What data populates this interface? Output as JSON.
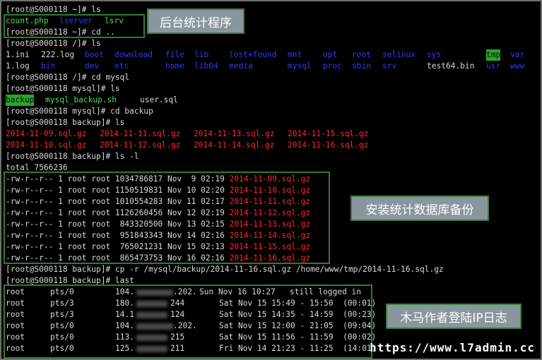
{
  "terminal": {
    "l01": "[root@S000118 ~]# ls",
    "l02": {
      "f1": "count.php",
      "f2": "lserver",
      "f3": "lsrv"
    },
    "l03": "[root@S000118 ~]# cd ..",
    "l04": "[root@S000118 /]# ls",
    "l05": [
      "1.ini",
      "222.log",
      "boot",
      "download",
      "file",
      "lib",
      "lost+found",
      "mnt",
      "opt",
      "root",
      "selinux",
      "sys",
      "tmp",
      "var"
    ],
    "l06": [
      "1.log",
      "bin",
      "dev",
      "etc",
      "home",
      "lib64",
      "media",
      "mysql",
      "proc",
      "sbin",
      "srv",
      "test64.bin",
      "usr",
      "www"
    ],
    "l07": "[root@S000118 /]# cd mysql",
    "l08": "[root@S000118 mysql]# ls",
    "l09": {
      "f1": "backup",
      "f2": "mysql_backup.sh",
      "f3": "user.sql"
    },
    "l10": "[root@S000118 mysql]# cd backup",
    "l11": "[root@S000118 backup]# ls",
    "l12": [
      "2014-11-09.sql.gz",
      "2014-11-11.sql.gz",
      "2014-11-13.sql.gz",
      "2014-11-15.sql.gz"
    ],
    "l13": [
      "2014-11-10.sql.gz",
      "2014-11-12.sql.gz",
      "2014-11-14.sql.gz",
      "2014-11-16.sql.gz"
    ],
    "l14": "[root@S000118 backup]# ls -l",
    "l15": "total 7566236",
    "listing": [
      {
        "info": "-rw-r--r-- 1 root root 1034786817 Nov  9 02:19 ",
        "name": "2014-11-09.sql.gz"
      },
      {
        "info": "-rw-r--r-- 1 root root 1150519831 Nov 10 02:20 ",
        "name": "2014-11-10.sql.gz"
      },
      {
        "info": "-rw-r--r-- 1 root root 1010554283 Nov 11 02:17 ",
        "name": "2014-11-11.sql.gz"
      },
      {
        "info": "-rw-r--r-- 1 root root 1126260456 Nov 12 02:19 ",
        "name": "2014-11-12.sql.gz"
      },
      {
        "info": "-rw-r--r-- 1 root root  843320500 Nov 13 02:15 ",
        "name": "2014-11-13.sql.gz"
      },
      {
        "info": "-rw-r--r-- 1 root root  951843343 Nov 14 02:16 ",
        "name": "2014-11-14.sql.gz"
      },
      {
        "info": "-rw-r--r-- 1 root root  765021231 Nov 15 02:13 ",
        "name": "2014-11-15.sql.gz"
      },
      {
        "info": "-rw-r--r-- 1 root root  865473753 Nov 16 02:16 ",
        "name": "2014-11-16.sql.gz"
      }
    ],
    "l24": "[root@S000118 backup]# cp -r /mysql/backup/2014-11-16.sql.gz /home/www/tmp/2014-11-16.sql.gz",
    "l25": "[root@S000118 backup]# last",
    "last": [
      {
        "user": "root",
        "tty": "pts/0",
        "ip_a": "104.",
        "ip_b": ".202.",
        "time": "Sun Nov 16 10:27   still logged in"
      },
      {
        "user": "root",
        "tty": "pts/3",
        "ip_a": "180.",
        "ip_b": "244",
        "time": "Sat Nov 15 15:49 - 15:50  (00:01)"
      },
      {
        "user": "root",
        "tty": "pts/3",
        "ip_a": "14.1",
        "ip_b": "124",
        "time": "Sat Nov 15 14:35 - 14:59  (00:23)"
      },
      {
        "user": "root",
        "tty": "pts/0",
        "ip_a": "104.",
        "ip_b": ".202.",
        "time": "Sat Nov 15 12:00 - 21:05  (09:04)"
      },
      {
        "user": "root",
        "tty": "pts/0",
        "ip_a": "113.",
        "ip_b": "215",
        "time": "Sat Nov 15 11:56 - 11:59  (00:02)"
      },
      {
        "user": "root",
        "tty": "pts/0",
        "ip_a": "125.",
        "ip_b": "211",
        "time": "Fri Nov 14 21:23 - 11:25  (14:01)"
      }
    ]
  },
  "annotations": {
    "backend_program": "后台统计程序",
    "db_backup": "安装统计数据库备份",
    "trojan_login_log": "木马作者登陆IP日志"
  },
  "watermark": "https://www.l7admin.cc",
  "colors": {
    "dir_blue": "#2d3cf0",
    "exec_green": "#44e644",
    "archive_red": "#ff2626",
    "highlight_green": "#2aa52a",
    "annotation_bg": "#8a969e"
  }
}
